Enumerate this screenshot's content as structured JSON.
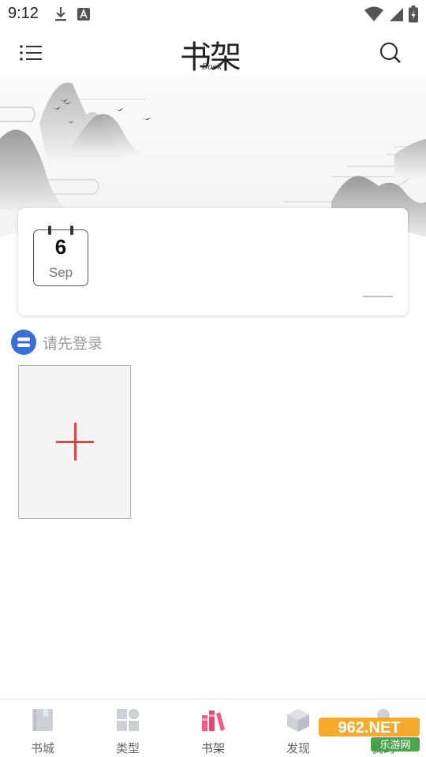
{
  "status_bar": {
    "time": "9:12",
    "left_icons": [
      "download-icon",
      "text-a-icon"
    ],
    "right_icons": [
      "wifi-icon",
      "signal-icon",
      "battery-icon"
    ]
  },
  "header": {
    "title": "书架",
    "subtitle": "Book",
    "menu_icon": "menu-icon",
    "search_icon": "search-icon"
  },
  "date_card": {
    "day": "6",
    "month": "Sep"
  },
  "login": {
    "text": "请先登录"
  },
  "add_book": {
    "icon": "plus-icon",
    "accent_color": "#e04545"
  },
  "bottom_nav": {
    "items": [
      {
        "label": "书城",
        "icon": "book-icon",
        "active": false
      },
      {
        "label": "类型",
        "icon": "grid-icon",
        "active": false
      },
      {
        "label": "书架",
        "icon": "bookshelf-icon",
        "active": true
      },
      {
        "label": "发现",
        "icon": "cube-icon",
        "active": false
      },
      {
        "label": "我的",
        "icon": "user-icon",
        "active": false
      }
    ],
    "active_color": "#f04478"
  },
  "watermark": {
    "brand": "962.NET",
    "site": "乐游网"
  }
}
